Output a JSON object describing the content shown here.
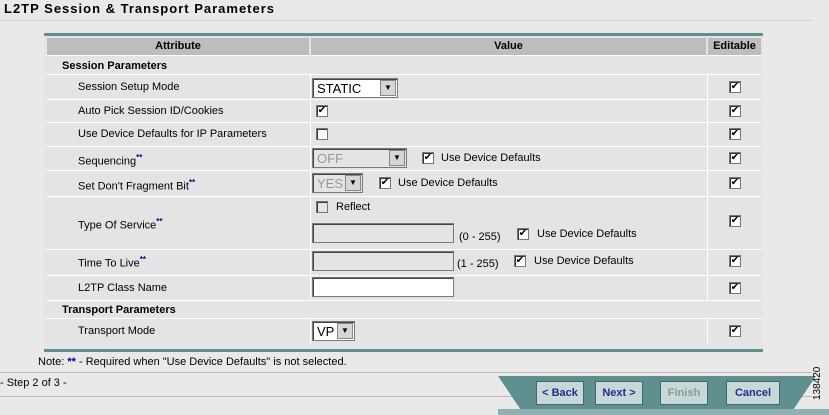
{
  "page": {
    "title": "L2TP Session & Transport Parameters"
  },
  "table": {
    "headers": {
      "attribute": "Attribute",
      "value": "Value",
      "editable": "Editable"
    },
    "session_section": "Session Parameters",
    "transport_section": "Transport Parameters",
    "rows": {
      "setup_mode": {
        "label": "Session Setup Mode",
        "value": "STATIC",
        "editable": true
      },
      "auto_pick": {
        "label": "Auto Pick Session ID/Cookies",
        "checked": true,
        "editable": true
      },
      "device_defaults_ip": {
        "label": "Use Device Defaults for IP Parameters",
        "checked": false,
        "editable": true
      },
      "sequencing": {
        "label": "Sequencing",
        "required_mark": "**",
        "value": "OFF",
        "use_defaults_label": "Use Device Defaults",
        "use_defaults": true,
        "editable": true
      },
      "dont_fragment": {
        "label": "Set Don't Fragment Bit",
        "required_mark": "**",
        "value": "YES",
        "use_defaults_label": "Use Device Defaults",
        "use_defaults": true,
        "editable": true
      },
      "tos": {
        "label": "Type Of Service",
        "required_mark": "**",
        "reflect_label": "Reflect",
        "reflect": false,
        "value": "",
        "range": "(0 - 255)",
        "use_defaults_label": "Use Device Defaults",
        "use_defaults": true,
        "editable": true
      },
      "ttl": {
        "label": "Time To Live",
        "required_mark": "**",
        "value": "",
        "range": "(1 - 255)",
        "use_defaults_label": "Use Device Defaults",
        "use_defaults": true,
        "editable": true
      },
      "class_name": {
        "label": "L2TP Class Name",
        "value": "",
        "editable": true
      },
      "transport_mode": {
        "label": "Transport Mode",
        "value": "VP",
        "editable": true
      }
    }
  },
  "note": {
    "prefix": "Note:",
    "mark": "**",
    "text": "- Required when \"Use Device Defaults\" is not selected."
  },
  "footer": {
    "step": "- Step 2 of 3 -",
    "back": "< Back",
    "next": "Next >",
    "finish": "Finish",
    "cancel": "Cancel"
  },
  "figure_id": "138420",
  "check_glyph": "✔"
}
